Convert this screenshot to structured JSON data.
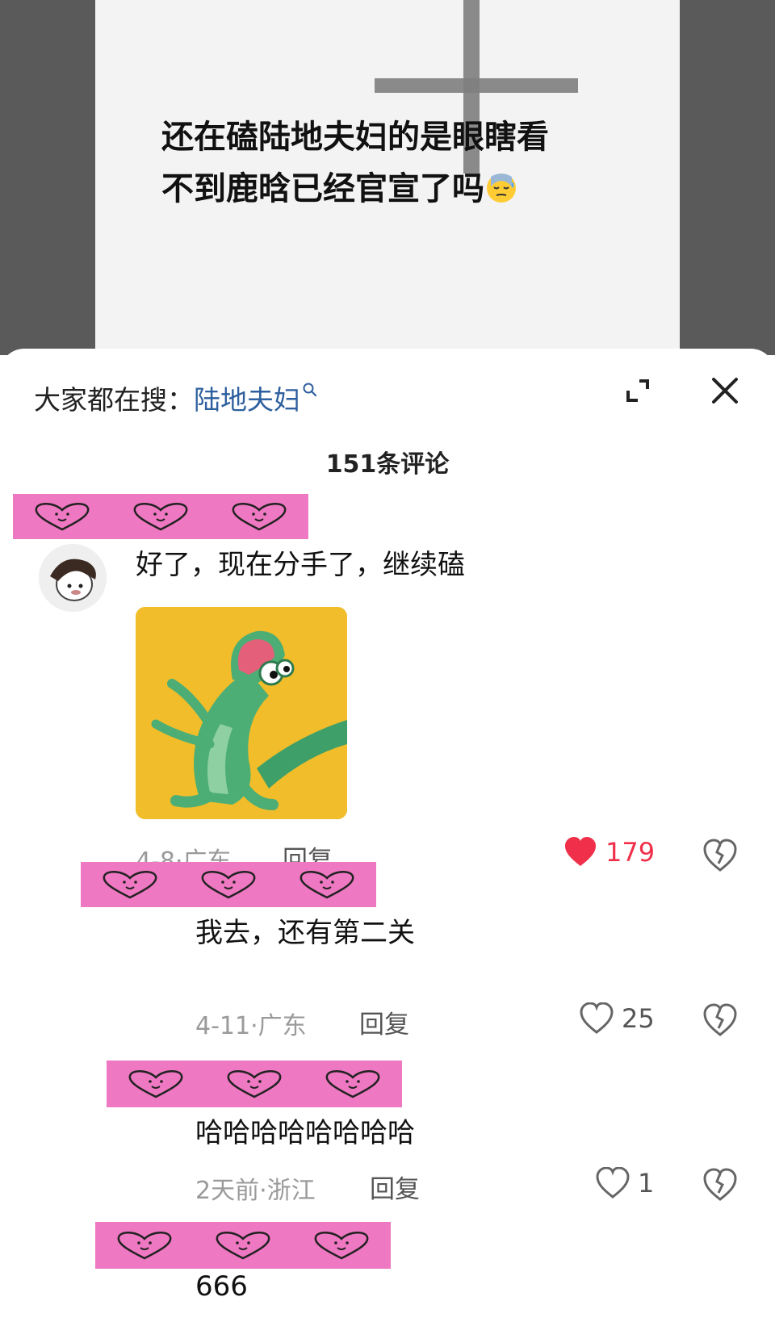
{
  "video": {
    "caption_lines": [
      "还在磕陆地夫妇的是眼瞎看",
      "不到鹿晗已经官宣了吗"
    ],
    "caption_emoji": "sweat-face-emoji"
  },
  "sheet": {
    "search_prefix": "大家都在搜：",
    "search_term": "陆地夫妇",
    "comment_count": "151条评论"
  },
  "comments": [
    {
      "text": "好了，现在分手了，继续磕",
      "meta": "4-8·广东",
      "reply": "回复",
      "likes": "179",
      "liked": true,
      "has_sticker": true
    },
    {
      "text": "我去，还有第二关",
      "meta": "4-11·广东",
      "reply": "回复",
      "likes": "25",
      "liked": false
    },
    {
      "text": "哈哈哈哈哈哈哈哈",
      "meta": "2天前·浙江",
      "reply": "回复",
      "likes": "1",
      "liked": false
    },
    {
      "text": "666"
    }
  ],
  "colors": {
    "accent_like": "#f0304a",
    "link": "#2e5f9e",
    "name_cover": "#ef78c2",
    "sticker_bg": "#f1bd2a"
  },
  "icons": [
    "search-icon",
    "expand-icon",
    "close-icon",
    "heart-icon",
    "broken-heart-icon"
  ]
}
